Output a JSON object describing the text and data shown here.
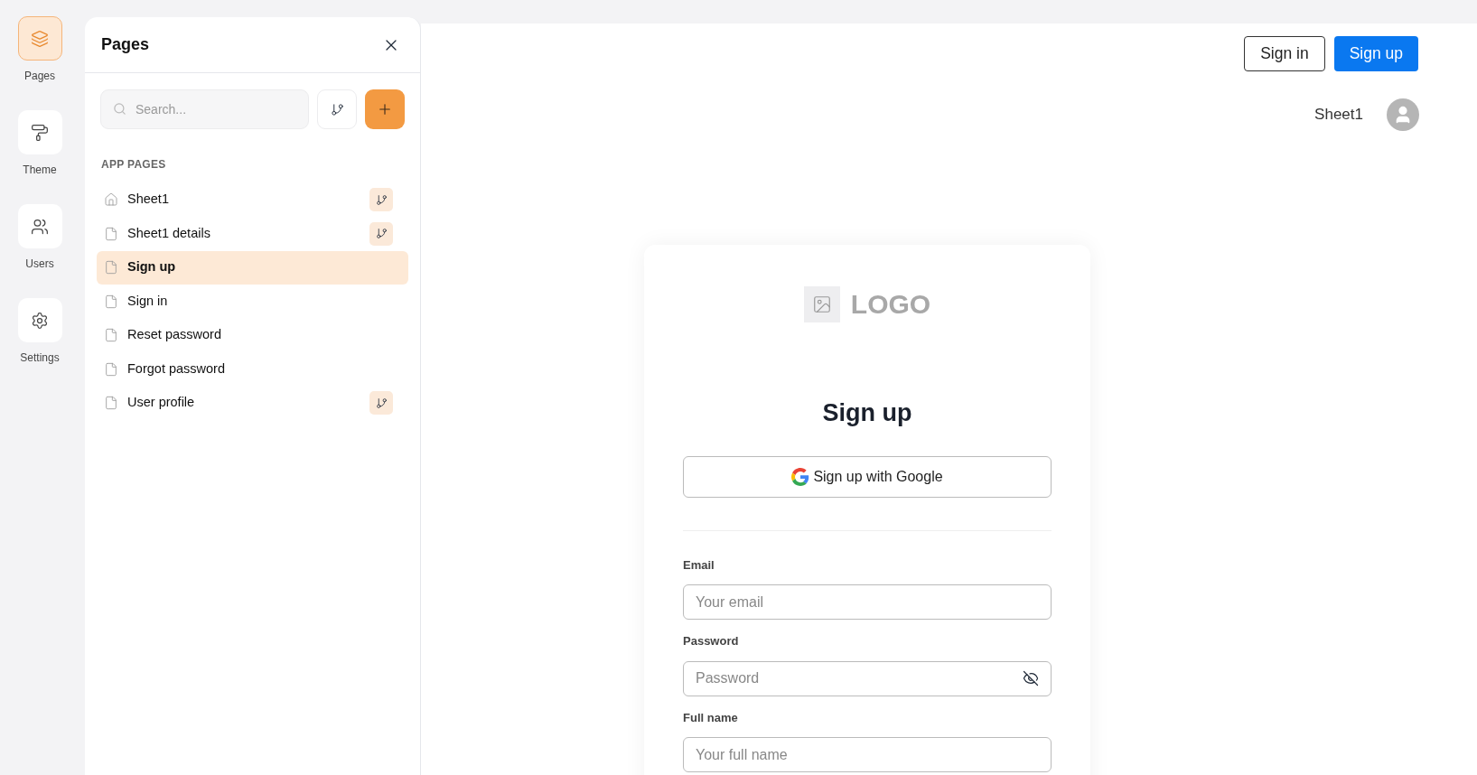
{
  "rail": [
    {
      "label": "Pages",
      "selected": true
    },
    {
      "label": "Theme",
      "selected": false
    },
    {
      "label": "Users",
      "selected": false
    },
    {
      "label": "Settings",
      "selected": false
    }
  ],
  "panel": {
    "title": "Pages",
    "search": {
      "placeholder": "Search..."
    },
    "section": "APP PAGES",
    "items": [
      {
        "label": "Sheet1",
        "kind": "home",
        "selected": false,
        "branch": true
      },
      {
        "label": "Sheet1 details",
        "kind": "page",
        "selected": false,
        "branch": true
      },
      {
        "label": "Sign up",
        "kind": "page",
        "selected": true,
        "branch": false
      },
      {
        "label": "Sign in",
        "kind": "page",
        "selected": false,
        "branch": false
      },
      {
        "label": "Reset password",
        "kind": "page",
        "selected": false,
        "branch": false
      },
      {
        "label": "Forgot password",
        "kind": "page",
        "selected": false,
        "branch": false
      },
      {
        "label": "User profile",
        "kind": "page",
        "selected": false,
        "branch": true
      }
    ]
  },
  "header": {
    "buttons": [
      {
        "label": "Sign in",
        "kind": "outline"
      },
      {
        "label": "Sign up",
        "kind": "primary"
      }
    ],
    "user": "Sheet1"
  },
  "card": {
    "logo": "LOGO",
    "title": "Sign up",
    "google": "Sign up with Google",
    "fields": [
      {
        "label": "Email",
        "placeholder": "Your email",
        "kind": "text"
      },
      {
        "label": "Password",
        "placeholder": "Password",
        "kind": "password"
      },
      {
        "label": "Full name",
        "placeholder": "Your full name",
        "kind": "text"
      }
    ]
  }
}
